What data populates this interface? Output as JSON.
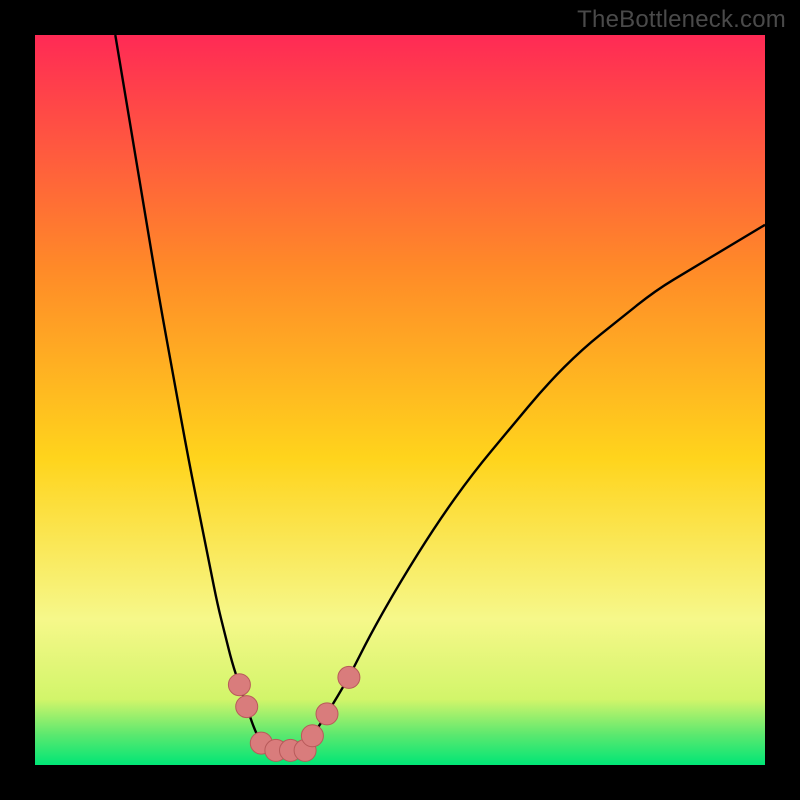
{
  "watermark": "TheBottleneck.com",
  "colors": {
    "frame": "#000000",
    "bg_top": "#ff2a55",
    "bg_25": "#ff8a28",
    "bg_50": "#ffd41c",
    "bg_75": "#f6f88a",
    "bg_88": "#d2f56a",
    "bg_95": "#58e86f",
    "bg_bottom": "#00e676",
    "curve": "#000000",
    "marker_fill": "#d97c7c",
    "marker_stroke": "#b85a5a"
  },
  "chart_data": {
    "type": "line",
    "title": "",
    "xlabel": "",
    "ylabel": "",
    "xlim": [
      0,
      100
    ],
    "ylim": [
      0,
      100
    ],
    "grid": false,
    "legend": false,
    "series": [
      {
        "name": "left-branch",
        "x": [
          11,
          13,
          15,
          17,
          19,
          21,
          23,
          24,
          25,
          26,
          27,
          28,
          29,
          30,
          31
        ],
        "y": [
          100,
          88,
          76,
          64,
          53,
          42,
          32,
          27,
          22,
          18,
          14,
          11,
          8,
          5,
          3
        ]
      },
      {
        "name": "right-branch",
        "x": [
          38,
          40,
          43,
          46,
          50,
          55,
          60,
          65,
          70,
          75,
          80,
          85,
          90,
          95,
          100
        ],
        "y": [
          4,
          7,
          12,
          18,
          25,
          33,
          40,
          46,
          52,
          57,
          61,
          65,
          68,
          71,
          74
        ]
      },
      {
        "name": "valley-floor",
        "x": [
          31,
          33,
          35,
          37,
          38
        ],
        "y": [
          3,
          2,
          2,
          2,
          4
        ]
      }
    ],
    "markers": [
      {
        "name": "left-upper-dot",
        "x": 28,
        "y": 11
      },
      {
        "name": "left-lower-dot",
        "x": 29,
        "y": 8
      },
      {
        "name": "floor-dot-1",
        "x": 31,
        "y": 3
      },
      {
        "name": "floor-dot-2",
        "x": 33,
        "y": 2
      },
      {
        "name": "floor-dot-3",
        "x": 35,
        "y": 2
      },
      {
        "name": "floor-dot-4",
        "x": 37,
        "y": 2
      },
      {
        "name": "right-lower-dot",
        "x": 38,
        "y": 4
      },
      {
        "name": "right-mid-dot",
        "x": 40,
        "y": 7
      },
      {
        "name": "right-upper-dot",
        "x": 43,
        "y": 12
      }
    ]
  }
}
